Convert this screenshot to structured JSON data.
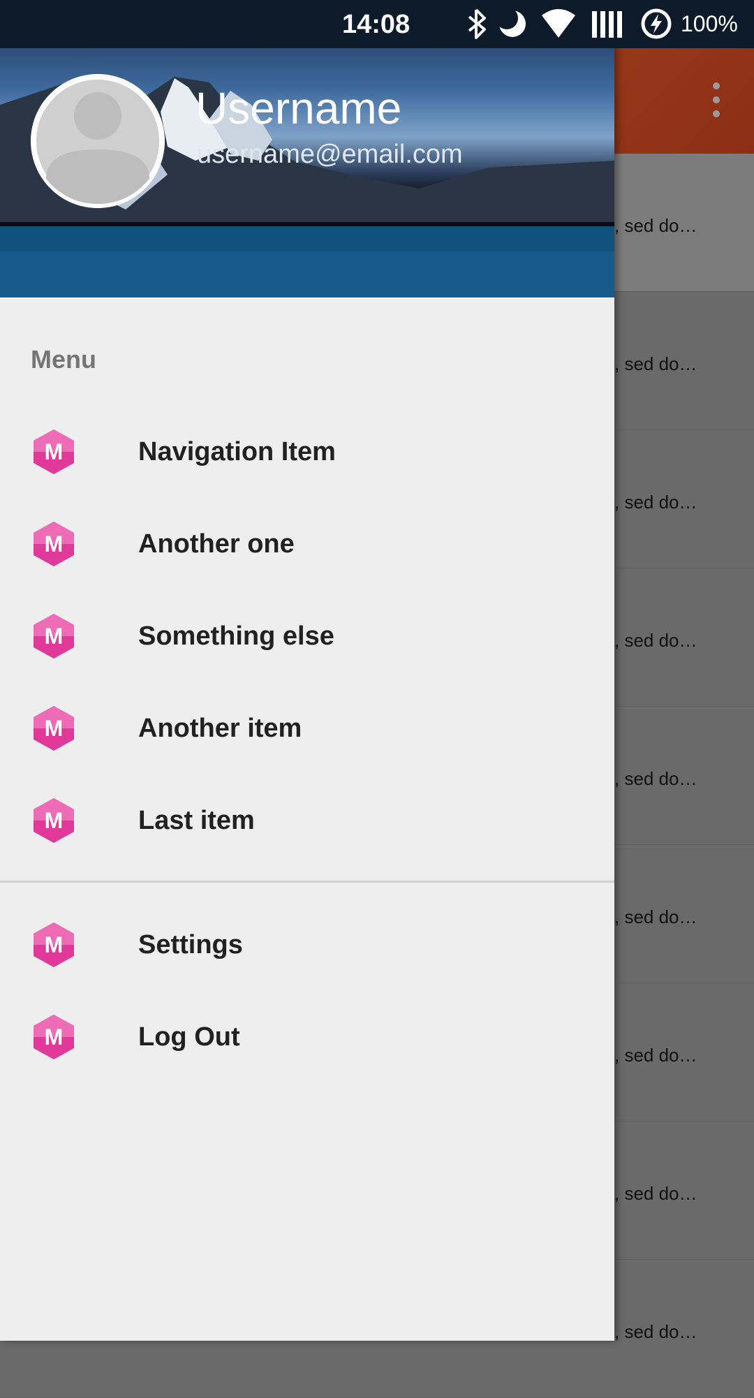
{
  "status_bar": {
    "time": "14:08",
    "battery": "100%",
    "icons": [
      "bluetooth-icon",
      "do-not-disturb-moon-icon",
      "wifi-icon",
      "signal-icon",
      "battery-charging-icon"
    ]
  },
  "background_app": {
    "list_item_snippet": ", sed do…",
    "overflow_icon": "more-vert-icon",
    "toolbar_color": "#b5461f"
  },
  "drawer": {
    "header": {
      "username": "Username",
      "email": "username@email.com",
      "avatar_icon": "person-avatar-icon"
    },
    "subheader": "Menu",
    "items": [
      {
        "label": "Navigation Item",
        "icon": "m-hexagon-icon"
      },
      {
        "label": "Another one",
        "icon": "m-hexagon-icon"
      },
      {
        "label": "Something else",
        "icon": "m-hexagon-icon"
      },
      {
        "label": "Another item",
        "icon": "m-hexagon-icon"
      },
      {
        "label": "Last item",
        "icon": "m-hexagon-icon"
      }
    ],
    "secondary_items": [
      {
        "label": "Settings",
        "icon": "m-hexagon-icon"
      },
      {
        "label": "Log Out",
        "icon": "m-hexagon-icon"
      }
    ],
    "icon_color": "#e0399a"
  }
}
